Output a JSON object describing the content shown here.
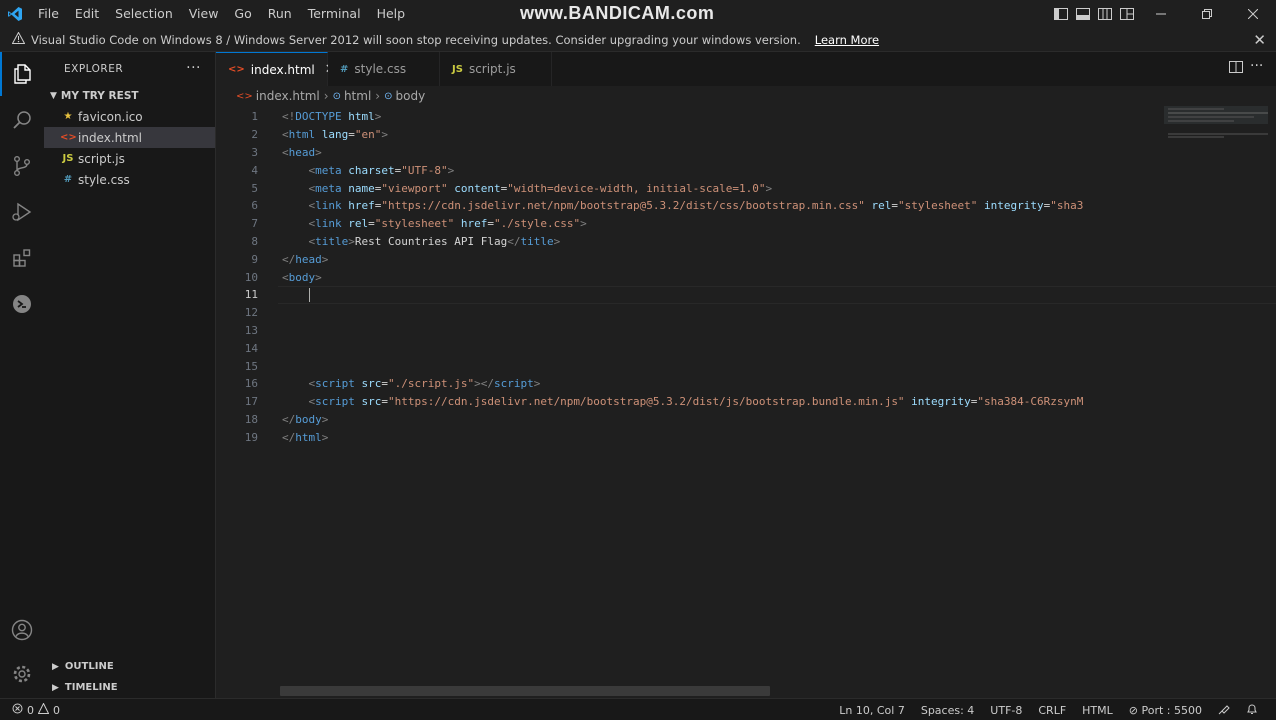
{
  "menu": [
    "File",
    "Edit",
    "Selection",
    "View",
    "Go",
    "Run",
    "Terminal",
    "Help"
  ],
  "watermark": "www.BANDICAM.com",
  "banner": {
    "message": "Visual Studio Code on Windows 8 / Windows Server 2012 will soon stop receiving updates. Consider upgrading your windows version.",
    "link": "Learn More"
  },
  "sidebar": {
    "title": "EXPLORER",
    "folder": "MY TRY REST",
    "files": [
      {
        "name": "favicon.ico",
        "icon": "★",
        "color": "#e8c23f"
      },
      {
        "name": "index.html",
        "icon": "<>",
        "color": "#e44d26"
      },
      {
        "name": "script.js",
        "icon": "JS",
        "color": "#cbcb41"
      },
      {
        "name": "style.css",
        "icon": "#",
        "color": "#519aba"
      }
    ],
    "outline": "OUTLINE",
    "timeline": "TIMELINE"
  },
  "tabs": [
    {
      "name": "index.html",
      "icon": "<>",
      "color": "#e44d26",
      "active": true
    },
    {
      "name": "style.css",
      "icon": "#",
      "color": "#519aba",
      "active": false
    },
    {
      "name": "script.js",
      "icon": "JS",
      "color": "#cbcb41",
      "active": false
    }
  ],
  "breadcrumb": [
    "index.html",
    "html",
    "body"
  ],
  "colors": {
    "tag": "#569cd6",
    "punct": "#808080",
    "attr": "#9cdcfe",
    "string": "#ce9178",
    "text": "#d4d4d4",
    "accent": "#0078d4"
  },
  "code_lines": [
    [
      [
        "p",
        "<!"
      ],
      [
        "t",
        "DOCTYPE"
      ],
      [
        "a",
        " html"
      ],
      [
        "p",
        ">"
      ]
    ],
    [
      [
        "p",
        "<"
      ],
      [
        "t",
        "html"
      ],
      [
        "a",
        " lang"
      ],
      [
        "x",
        "="
      ],
      [
        "s",
        "\"en\""
      ],
      [
        "p",
        ">"
      ]
    ],
    [
      [
        "p",
        "<"
      ],
      [
        "t",
        "head"
      ],
      [
        "p",
        ">"
      ]
    ],
    [
      [
        "x",
        "    "
      ],
      [
        "p",
        "<"
      ],
      [
        "t",
        "meta"
      ],
      [
        "a",
        " charset"
      ],
      [
        "x",
        "="
      ],
      [
        "s",
        "\"UTF-8\""
      ],
      [
        "p",
        ">"
      ]
    ],
    [
      [
        "x",
        "    "
      ],
      [
        "p",
        "<"
      ],
      [
        "t",
        "meta"
      ],
      [
        "a",
        " name"
      ],
      [
        "x",
        "="
      ],
      [
        "s",
        "\"viewport\""
      ],
      [
        "a",
        " content"
      ],
      [
        "x",
        "="
      ],
      [
        "s",
        "\"width=device-width, initial-scale=1.0\""
      ],
      [
        "p",
        ">"
      ]
    ],
    [
      [
        "x",
        "    "
      ],
      [
        "p",
        "<"
      ],
      [
        "t",
        "link"
      ],
      [
        "a",
        " href"
      ],
      [
        "x",
        "="
      ],
      [
        "s",
        "\"https://cdn.jsdelivr.net/npm/bootstrap@5.3.2/dist/css/bootstrap.min.css\""
      ],
      [
        "a",
        " rel"
      ],
      [
        "x",
        "="
      ],
      [
        "s",
        "\"stylesheet\""
      ],
      [
        "a",
        " integrity"
      ],
      [
        "x",
        "="
      ],
      [
        "s",
        "\"sha3"
      ]
    ],
    [
      [
        "x",
        "    "
      ],
      [
        "p",
        "<"
      ],
      [
        "t",
        "link"
      ],
      [
        "a",
        " rel"
      ],
      [
        "x",
        "="
      ],
      [
        "s",
        "\"stylesheet\""
      ],
      [
        "a",
        " href"
      ],
      [
        "x",
        "="
      ],
      [
        "s",
        "\"./style.css\""
      ],
      [
        "p",
        ">"
      ]
    ],
    [
      [
        "x",
        "    "
      ],
      [
        "p",
        "<"
      ],
      [
        "t",
        "title"
      ],
      [
        "p",
        ">"
      ],
      [
        "x",
        "Rest Countries API Flag"
      ],
      [
        "p",
        "</"
      ],
      [
        "t",
        "title"
      ],
      [
        "p",
        ">"
      ]
    ],
    [
      [
        "p",
        "</"
      ],
      [
        "t",
        "head"
      ],
      [
        "p",
        ">"
      ]
    ],
    [
      [
        "p",
        "<"
      ],
      [
        "t",
        "body"
      ],
      [
        "p",
        ">"
      ]
    ],
    [
      [
        "x",
        "    "
      ],
      [
        "c",
        ""
      ]
    ],
    [],
    [],
    [],
    [],
    [
      [
        "x",
        "    "
      ],
      [
        "p",
        "<"
      ],
      [
        "t",
        "script"
      ],
      [
        "a",
        " src"
      ],
      [
        "x",
        "="
      ],
      [
        "s",
        "\"./script.js\""
      ],
      [
        "p",
        "></"
      ],
      [
        "t",
        "script"
      ],
      [
        "p",
        ">"
      ]
    ],
    [
      [
        "x",
        "    "
      ],
      [
        "p",
        "<"
      ],
      [
        "t",
        "script"
      ],
      [
        "a",
        " src"
      ],
      [
        "x",
        "="
      ],
      [
        "s",
        "\"https://cdn.jsdelivr.net/npm/bootstrap@5.3.2/dist/js/bootstrap.bundle.min.js\""
      ],
      [
        "a",
        " integrity"
      ],
      [
        "x",
        "="
      ],
      [
        "s",
        "\"sha384-C6RzsynM"
      ]
    ],
    [
      [
        "p",
        "</"
      ],
      [
        "t",
        "body"
      ],
      [
        "p",
        ">"
      ]
    ],
    [
      [
        "p",
        "</"
      ],
      [
        "t",
        "html"
      ],
      [
        "p",
        ">"
      ]
    ]
  ],
  "current_line": 11,
  "status": {
    "problems": "0",
    "warnings": "0",
    "position": "Ln 10, Col 7",
    "spaces": "Spaces: 4",
    "encoding": "UTF-8",
    "eol": "CRLF",
    "language": "HTML",
    "port": "Port : 5500"
  }
}
